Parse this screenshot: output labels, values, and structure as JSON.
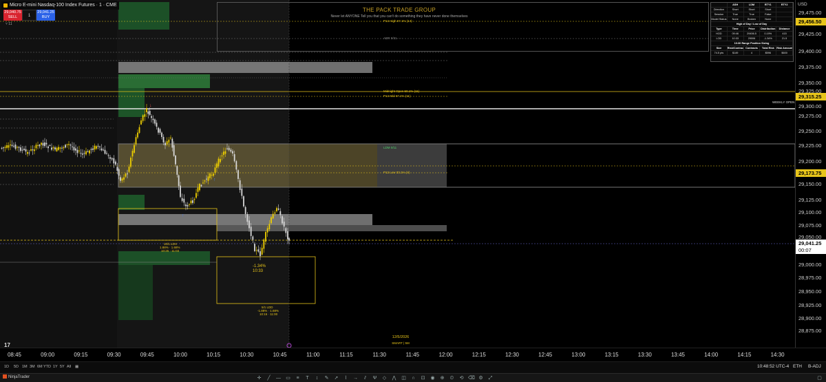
{
  "window": {
    "title": "Micro E-mini Nasdaq-100 Index Futures · 1 · CME",
    "app_name": "NinjaTrader",
    "currency": "USD"
  },
  "order_panel": {
    "sell_price": "29,040.75",
    "sell_label": "SELL",
    "buy_price": "29,041.25",
    "buy_label": "BUY",
    "quantity": "1",
    "expand_label": "˅ 11"
  },
  "banner": {
    "title": "THE PACK TRADE GROUP",
    "subtitle": "Never let ANYONE Tell you that you can't do something they have never done themselves"
  },
  "stats_table": {
    "header": [
      "",
      "ASH",
      "LDM",
      "RTY1",
      "RTY2"
    ],
    "rows": [
      [
        "Direction",
        "Short",
        "Short",
        "Short",
        ""
      ],
      [
        "Session",
        "True",
        "True",
        "False",
        ""
      ],
      [
        "Model Status",
        "None",
        "Broken",
        "None",
        ""
      ]
    ],
    "section_1_title": "High of Day / Low of Day",
    "section_1_header": [
      "Type",
      "Time",
      "Price",
      "Distribution",
      "Distance"
    ],
    "section_1_rows": [
      [
        "HOD",
        "09:46",
        "29456.5",
        "0.19%",
        "415"
      ],
      [
        "LOD",
        "10:33",
        "29006",
        "-1.34%",
        "21.5"
      ]
    ],
    "section_2_title": "10:30 Range Position Sizing",
    "section_2_header": [
      "Size",
      "Risk/Contract",
      "Contracts",
      "Total Risk",
      "Risk Amount"
    ],
    "section_2_rows": [
      [
        "74.5 pts",
        "$149",
        "4",
        "$596",
        "$600"
      ]
    ]
  },
  "levels": {
    "p12_high": "P12 High 67.1% (14)",
    "adr_high": "ADR 0/31 ·····",
    "midnight_open": "Midnight Open 50.1% (11)",
    "p12_mid": "P12 Mid 67.1% (11)",
    "weekly_open": "WEEKLY OPEN",
    "ldm": "LDM 0/11",
    "p12_low": "P12 Low 33.1% (4)"
  },
  "annotations": {
    "lod_pct": "-1.34%",
    "lod_time": "10:33",
    "range_note": "10/1 LDH",
    "range_note_2": "1.88% · 1.68%",
    "range_note_3": "10:25 · 11:03",
    "box_note": "5/1 LDD",
    "box_note_2": "-1.88% · 1.68%",
    "box_note_3": "10:15 · 11:00",
    "date": "12/5/2026",
    "date_sub": "SMART | 5M",
    "tv_logo": "17"
  },
  "price_axis": {
    "ticks": [
      "29,475.00",
      "29,425.00",
      "29,400.00",
      "29,375.00",
      "29,350.00",
      "29,325.00",
      "29,300.00",
      "29,275.00",
      "29,250.00",
      "29,225.00",
      "29,200.00",
      "29,150.00",
      "29,125.00",
      "29,100.00",
      "29,075.00",
      "29,050.00",
      "29,000.00",
      "28,975.00",
      "28,950.00",
      "28,925.00",
      "28,900.00",
      "28,875.00"
    ],
    "tag_high": "29,456.50",
    "tag_weekly": "29,315.25",
    "tag_mid": "29,173.75",
    "tag_last": "29,041.25",
    "tag_countdown": "00:07"
  },
  "time_axis": [
    "08:45",
    "09:00",
    "09:15",
    "09:30",
    "09:45",
    "10:00",
    "10:15",
    "10:30",
    "10:45",
    "11:00",
    "11:15",
    "11:30",
    "11:45",
    "12:00",
    "12:15",
    "12:30",
    "12:45",
    "13:00",
    "13:15",
    "13:30",
    "13:45",
    "14:00",
    "14:15",
    "14:30"
  ],
  "bottom_bar": {
    "timeframes": [
      "1D",
      "5D",
      "1M",
      "3M",
      "6M",
      "YTD",
      "1Y",
      "5Y",
      "All"
    ],
    "clock": "10:48:52 UTC-4",
    "session": "ETH",
    "adjustment": "B-ADJ"
  },
  "colors": {
    "candle_up": "#f0d000",
    "candle_down": "#d8d8d8",
    "level_yellow": "#e8c51a",
    "zone_green": "#2e7d3a",
    "zone_grey": "#9a9a9a",
    "zone_tan": "#8a7b47"
  }
}
